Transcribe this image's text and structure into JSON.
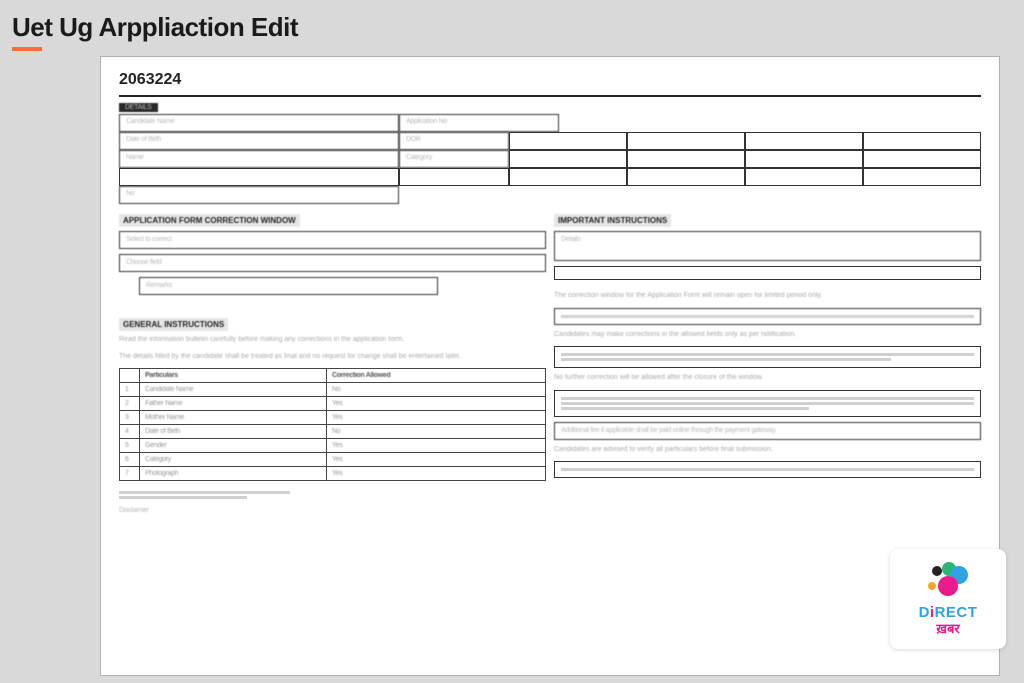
{
  "header": {
    "title": "Uet Ug Arppliaction Edit"
  },
  "form": {
    "year": "2063224",
    "section1_label": "DETAILS",
    "grid1": {
      "r1c1": "Candidate Name",
      "r1c2": "Application No",
      "r2c1": "Date of Birth",
      "r2c2": "DOB",
      "r3c1": "Name",
      "r3c2": "Category",
      "r4c1": "",
      "r5c1": "No"
    },
    "left": {
      "heading": "APPLICATION FORM CORRECTION WINDOW",
      "box1": "Select to correct",
      "box2": "Choose field",
      "box3": "Remarks"
    },
    "right": {
      "heading": "IMPORTANT INSTRUCTIONS",
      "box1": "Details",
      "line1": "The correction window for the Application Form will remain open for limited period only.",
      "line2": "Candidates may make corrections in the allowed fields only as per notification.",
      "line3": "No further correction will be allowed after the closure of the window.",
      "line4": "Additional fee if applicable shall be paid online through the payment gateway.",
      "line5": "Candidates are advised to verify all particulars before final submission."
    },
    "notes_heading": "GENERAL INSTRUCTIONS",
    "notes1": "Read the information bulletin carefully before making any corrections in the application form.",
    "notes2": "The details filled by the candidate shall be treated as final and no request for change shall be entertained later.",
    "table_left": {
      "h1": "Particulars",
      "h2": "Correction Allowed",
      "rows": [
        [
          "Candidate Name",
          "No"
        ],
        [
          "Father Name",
          "Yes"
        ],
        [
          "Mother Name",
          "Yes"
        ],
        [
          "Date of Birth",
          "No"
        ],
        [
          "Gender",
          "Yes"
        ],
        [
          "Category",
          "Yes"
        ],
        [
          "Photograph",
          "Yes"
        ]
      ]
    },
    "footer_note": "Disclaimer"
  },
  "logo": {
    "line1_pre": "D",
    "line1_i": "i",
    "line1_post": "RECT",
    "line2": "ख़बर"
  }
}
